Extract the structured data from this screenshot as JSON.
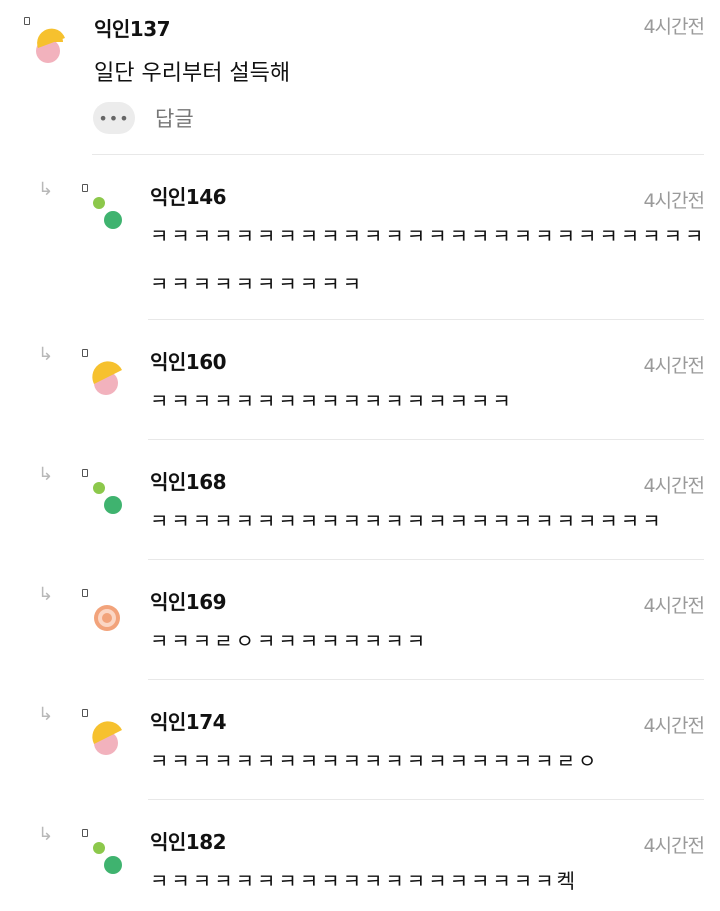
{
  "comment": {
    "name": "익인137",
    "time": "4시간전",
    "text": "일단 우리부터 설득해",
    "more": "•••",
    "reply_label": "답글"
  },
  "replies": [
    {
      "name": "익인146",
      "time": "4시간전",
      "lines": [
        "ㅋㅋㅋㅋㅋㅋㅋㅋㅋㅋㅋㅋㅋㅋㅋㅋㅋㅋㅋㅋㅋㅋㅋㅋㅋㅋ",
        "ㅋㅋㅋㅋㅋㅋㅋㅋㅋㅋ"
      ],
      "avatar": "dots"
    },
    {
      "name": "익인160",
      "time": "4시간전",
      "lines": [
        "ㅋㅋㅋㅋㅋㅋㅋㅋㅋㅋㅋㅋㅋㅋㅋㅋㅋ"
      ],
      "avatar": "moon"
    },
    {
      "name": "익인168",
      "time": "4시간전",
      "lines": [
        "ㅋㅋㅋㅋㅋㅋㅋㅋㅋㅋㅋㅋㅋㅋㅋㅋㅋㅋㅋㅋㅋㅋㅋㅋ"
      ],
      "avatar": "dots"
    },
    {
      "name": "익인169",
      "time": "4시간전",
      "lines": [
        "ㅋㅋㅋㄹㅇㅋㅋㅋㅋㅋㅋㅋㅋ"
      ],
      "avatar": "ring"
    },
    {
      "name": "익인174",
      "time": "4시간전",
      "lines": [
        "ㅋㅋㅋㅋㅋㅋㅋㅋㅋㅋㅋㅋㅋㅋㅋㅋㅋㅋㅋㄹㅇ"
      ],
      "avatar": "moon"
    },
    {
      "name": "익인182",
      "time": "4시간전",
      "lines": [
        "ㅋㅋㅋㅋㅋㅋㅋㅋㅋㅋㅋㅋㅋㅋㅋㅋㅋㅋㅋ켁"
      ],
      "avatar": "dots"
    }
  ],
  "colors": {
    "yellow": "#f6c12e",
    "pink": "#f2b2bd",
    "light_green": "#8cc84b",
    "green": "#3fb36f",
    "orange": "#f2a37b"
  },
  "icons": {
    "reply_arrow": "reply-indent-arrow-icon",
    "more": "more-dots-icon"
  }
}
